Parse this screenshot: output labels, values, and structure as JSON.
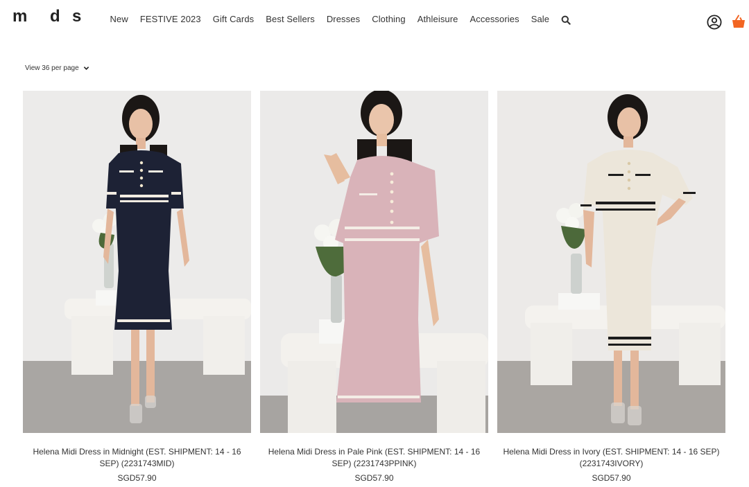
{
  "brand": {
    "logo_letters": [
      "m",
      "d",
      "s"
    ]
  },
  "nav": {
    "items": [
      "New",
      "FESTIVE 2023",
      "Gift Cards",
      "Best Sellers",
      "Dresses",
      "Clothing",
      "Athleisure",
      "Accessories",
      "Sale"
    ],
    "search_icon": "search-icon"
  },
  "header_icons": {
    "account": "account-icon",
    "cart": "shopping-basket-icon"
  },
  "colors": {
    "cart_accent": "#f26522",
    "text": "#333333"
  },
  "listing": {
    "per_page_label": "View 36 per page"
  },
  "products": [
    {
      "name": "Helena Midi Dress in Midnight (EST. SHIPMENT: 14 - 16 SEP) (2231743MID)",
      "price": "SGD57.90",
      "dress_color": "#1d2235",
      "trim_color": "#f2ece2"
    },
    {
      "name": "Helena Midi Dress in Pale Pink (EST. SHIPMENT: 14 - 16 SEP) (2231743PPINK)",
      "price": "SGD57.90",
      "dress_color": "#d9b3b9",
      "trim_color": "#f4ede6"
    },
    {
      "name": "Helena Midi Dress in Ivory (EST. SHIPMENT: 14 - 16 SEP) (2231743IVORY)",
      "price": "SGD57.90",
      "dress_color": "#ece6da",
      "trim_color": "#1c1c1c"
    }
  ]
}
